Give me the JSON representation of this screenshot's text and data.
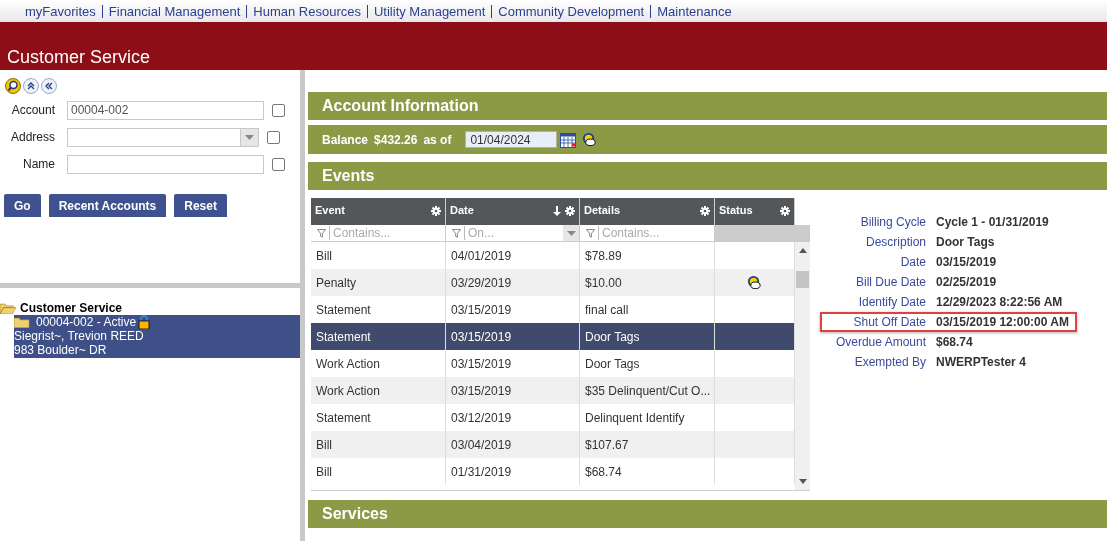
{
  "nav": [
    "myFavorites",
    "Financial Management",
    "Human Resources",
    "Utility Management",
    "Community Development",
    "Maintenance"
  ],
  "app_title": "Customer Service",
  "search": {
    "fields": [
      {
        "label": "Account",
        "kind": "text",
        "value": "00004-002",
        "checked": false
      },
      {
        "label": "Address",
        "kind": "select",
        "checked": false
      },
      {
        "label": "Name",
        "kind": "text",
        "checked": false
      }
    ],
    "buttons": [
      "Go",
      "Recent Accounts",
      "Reset"
    ]
  },
  "tree": {
    "label": "Customer Service",
    "expanded": true,
    "children": [
      {
        "lines": [
          "00004-002 - Active",
          "Siegrist~, Trevion REED",
          "983 Boulder~ DR"
        ],
        "selected": true
      }
    ]
  },
  "account_info": {
    "title": "Account Information",
    "balance_label": "Balance",
    "balance": "$432.26",
    "as_of_label": "as of",
    "date": "01/04/2024"
  },
  "events": {
    "title": "Events",
    "columns": [
      {
        "label": "Event",
        "sorted": false,
        "filter": "Contains...",
        "kind": "text"
      },
      {
        "label": "Date",
        "sorted": true,
        "filter": "On...",
        "kind": "date"
      },
      {
        "label": "Details",
        "sorted": false,
        "filter": "Contains...",
        "kind": "text"
      },
      {
        "label": "Status",
        "sorted": false,
        "kind": "none"
      }
    ],
    "rows": [
      {
        "event": "Bill",
        "date": "04/01/2019",
        "details": "$78.89",
        "status_icon": false,
        "selected": false
      },
      {
        "event": "Penalty",
        "date": "03/29/2019",
        "details": "$10.00",
        "status_icon": true,
        "selected": false
      },
      {
        "event": "Statement",
        "date": "03/15/2019",
        "details": "final call",
        "status_icon": false,
        "selected": false
      },
      {
        "event": "Statement",
        "date": "03/15/2019",
        "details": "Door Tags",
        "status_icon": false,
        "selected": true
      },
      {
        "event": "Work Action",
        "date": "03/15/2019",
        "details": "Door Tags",
        "status_icon": false,
        "selected": false
      },
      {
        "event": "Work Action",
        "date": "03/15/2019",
        "details": "$35 Delinquent/Cut O...",
        "status_icon": false,
        "selected": false
      },
      {
        "event": "Statement",
        "date": "03/12/2019",
        "details": "Delinquent Identify",
        "status_icon": false,
        "selected": false
      },
      {
        "event": "Bill",
        "date": "03/04/2019",
        "details": "$107.67",
        "status_icon": false,
        "selected": false
      },
      {
        "event": "Bill",
        "date": "01/31/2019",
        "details": "$68.74",
        "status_icon": false,
        "selected": false
      }
    ]
  },
  "details": [
    {
      "label": "Billing Cycle",
      "value": "Cycle 1 - 01/31/2019",
      "highlighted": false
    },
    {
      "label": "Description",
      "value": "Door Tags",
      "highlighted": false
    },
    {
      "label": "Date",
      "value": "03/15/2019",
      "highlighted": false
    },
    {
      "label": "Bill Due Date",
      "value": "02/25/2019",
      "highlighted": false
    },
    {
      "label": "Identify Date",
      "value": "12/29/2023 8:22:56 AM",
      "highlighted": false
    },
    {
      "label": "Shut Off Date",
      "value": "03/15/2019 12:00:00 AM",
      "highlighted": true
    },
    {
      "label": "Overdue Amount",
      "value": "$68.74",
      "highlighted": false
    },
    {
      "label": "Exempted By",
      "value": "NWERPTester 4",
      "highlighted": false
    }
  ],
  "services": {
    "title": "Services"
  }
}
